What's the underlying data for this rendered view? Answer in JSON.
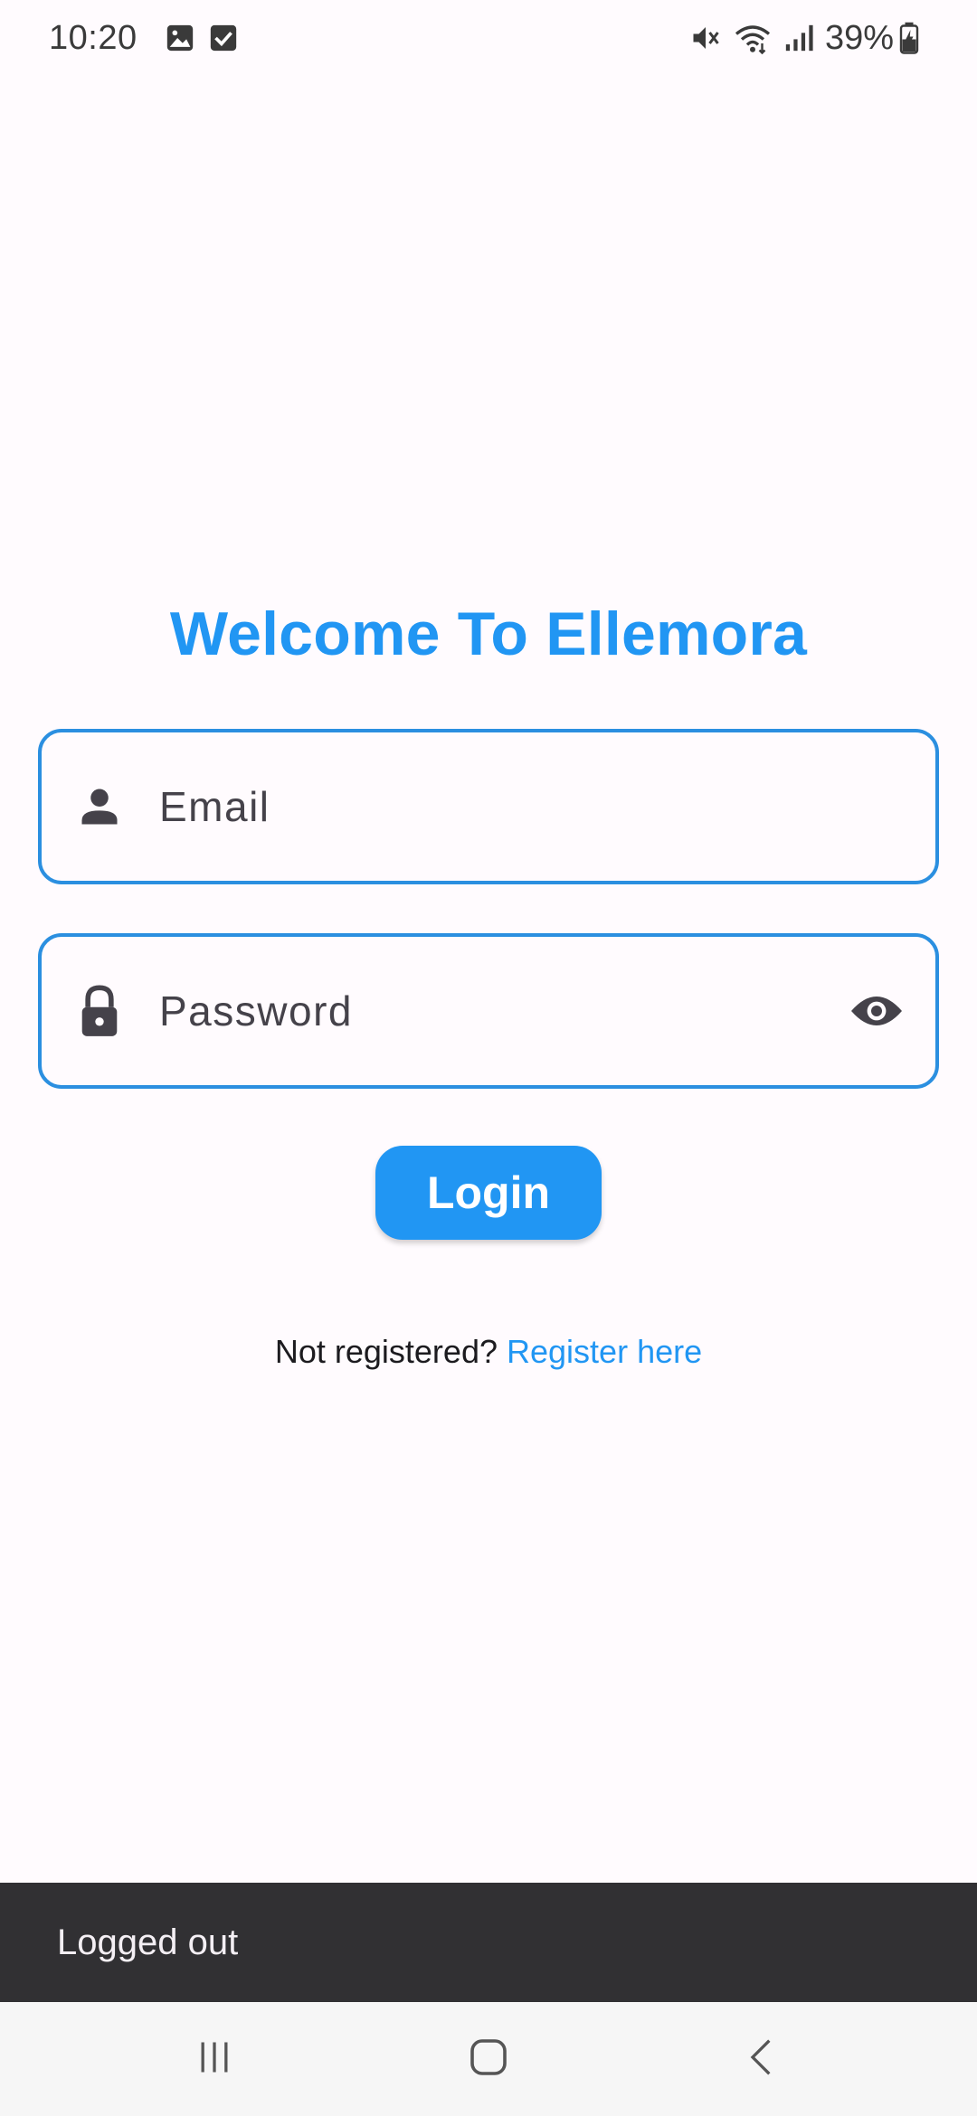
{
  "status_bar": {
    "time": "10:20",
    "battery": "39%",
    "icons_left": [
      "gallery-notification-icon",
      "checkbox-notification-icon"
    ],
    "icons_right": [
      "mute-icon",
      "wifi-icon",
      "signal-icon",
      "battery-charging-icon"
    ]
  },
  "login": {
    "title": "Welcome To Ellemora",
    "email": {
      "placeholder": "Email",
      "value": "",
      "icon": "person-icon"
    },
    "password": {
      "placeholder": "Password",
      "value": "",
      "icon": "lock-icon",
      "toggle_icon": "eye-icon"
    },
    "login_button": "Login",
    "register_prompt": "Not registered?",
    "register_link": "Register here"
  },
  "snackbar": {
    "message": "Logged out"
  },
  "nav_bar": {
    "buttons": [
      "recents-icon",
      "home-icon",
      "back-icon"
    ]
  },
  "colors": {
    "accent": "#2196f3",
    "field_border": "#2b8fe0",
    "background": "#fffbfe",
    "snackbar_bg": "#313033",
    "icon": "#45424a"
  }
}
